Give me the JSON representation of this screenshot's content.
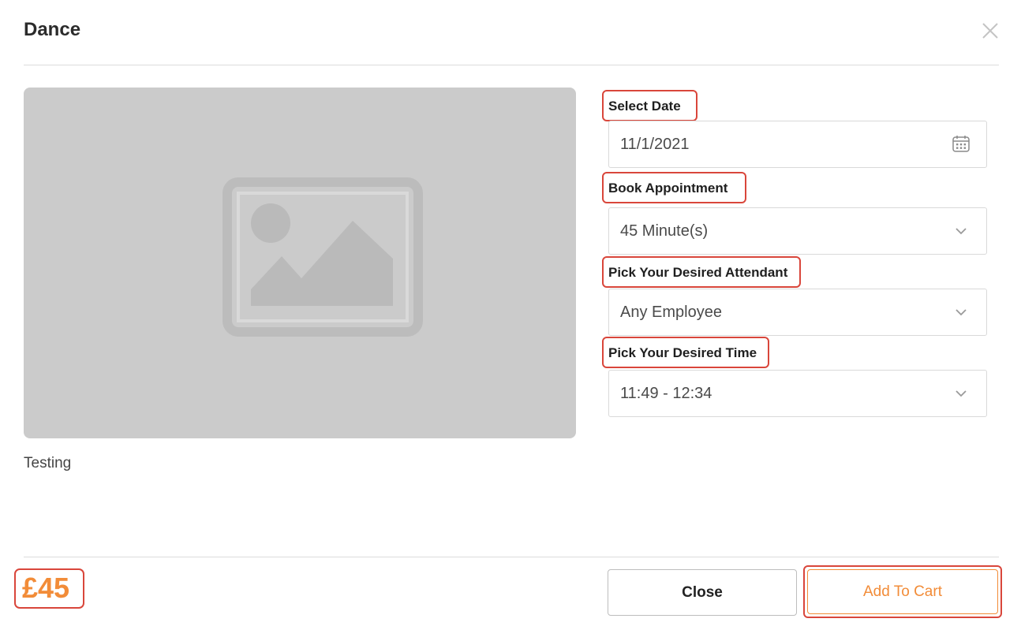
{
  "modal": {
    "title": "Dance",
    "description": "Testing"
  },
  "form": {
    "date": {
      "label": "Select Date",
      "value": "11/1/2021",
      "icon": "calendar-icon"
    },
    "appointment": {
      "label": "Book Appointment",
      "value": "45 Minute(s)",
      "icon": "chevron-down-icon"
    },
    "attendant": {
      "label": "Pick Your Desired Attendant",
      "value": "Any Employee",
      "icon": "chevron-down-icon"
    },
    "time": {
      "label": "Pick Your Desired Time",
      "value": "11:49 - 12:34",
      "icon": "chevron-down-icon"
    }
  },
  "footer": {
    "price": "£45",
    "close_label": "Close",
    "add_to_cart_label": "Add To Cart"
  },
  "colors": {
    "accent": "#f28c38",
    "highlight": "#d9463b",
    "placeholder_bg": "#cbcbcb"
  }
}
